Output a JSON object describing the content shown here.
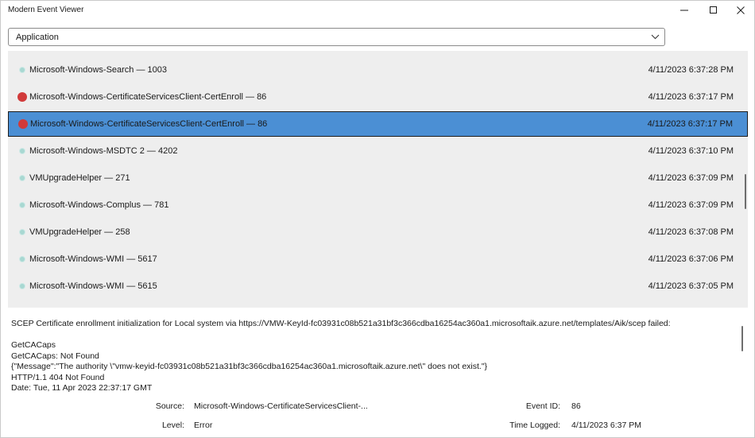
{
  "window": {
    "title": "Modern Event Viewer"
  },
  "log_selector": {
    "selected": "Application"
  },
  "events": [
    {
      "label": "Microsoft-Windows-Search — 1003",
      "time": "4/11/2023 6:37:28 PM",
      "level": "info",
      "selected": false
    },
    {
      "label": "Microsoft-Windows-CertificateServicesClient-CertEnroll — 86",
      "time": "4/11/2023 6:37:17 PM",
      "level": "error",
      "selected": false
    },
    {
      "label": "Microsoft-Windows-CertificateServicesClient-CertEnroll — 86",
      "time": "4/11/2023 6:37:17 PM",
      "level": "error",
      "selected": true
    },
    {
      "label": "Microsoft-Windows-MSDTC 2 — 4202",
      "time": "4/11/2023 6:37:10 PM",
      "level": "info",
      "selected": false
    },
    {
      "label": "VMUpgradeHelper — 271",
      "time": "4/11/2023 6:37:09 PM",
      "level": "info",
      "selected": false
    },
    {
      "label": "Microsoft-Windows-Complus — 781",
      "time": "4/11/2023 6:37:09 PM",
      "level": "info",
      "selected": false
    },
    {
      "label": "VMUpgradeHelper — 258",
      "time": "4/11/2023 6:37:08 PM",
      "level": "info",
      "selected": false
    },
    {
      "label": "Microsoft-Windows-WMI — 5617",
      "time": "4/11/2023 6:37:06 PM",
      "level": "info",
      "selected": false
    },
    {
      "label": "Microsoft-Windows-WMI — 5615",
      "time": "4/11/2023 6:37:05 PM",
      "level": "info",
      "selected": false
    }
  ],
  "detail": {
    "lines": [
      "SCEP Certificate enrollment initialization for Local system via https://VMW-KeyId-fc03931c08b521a31bf3c366cdba16254ac360a1.microsoftaik.azure.net/templates/Aik/scep failed:",
      "",
      "GetCACaps",
      "GetCACaps: Not Found",
      "{\"Message\":\"The authority \\\"vmw-keyid-fc03931c08b521a31bf3c366cdba16254ac360a1.microsoftaik.azure.net\\\" does not exist.\"}",
      "HTTP/1.1 404 Not Found",
      "Date: Tue, 11 Apr 2023 22:37:17 GMT"
    ],
    "source_label": "Source:",
    "source_value": "Microsoft-Windows-CertificateServicesClient-...",
    "level_label": "Level:",
    "level_value": "Error",
    "event_id_label": "Event ID:",
    "event_id_value": "86",
    "time_logged_label": "Time Logged:",
    "time_logged_value": "4/11/2023 6:37 PM"
  },
  "colors": {
    "selection": "#4b8fd4",
    "error_dot": "#d13a3a",
    "info_dot": "#a8d8d2",
    "list_background": "#eeeeee"
  }
}
